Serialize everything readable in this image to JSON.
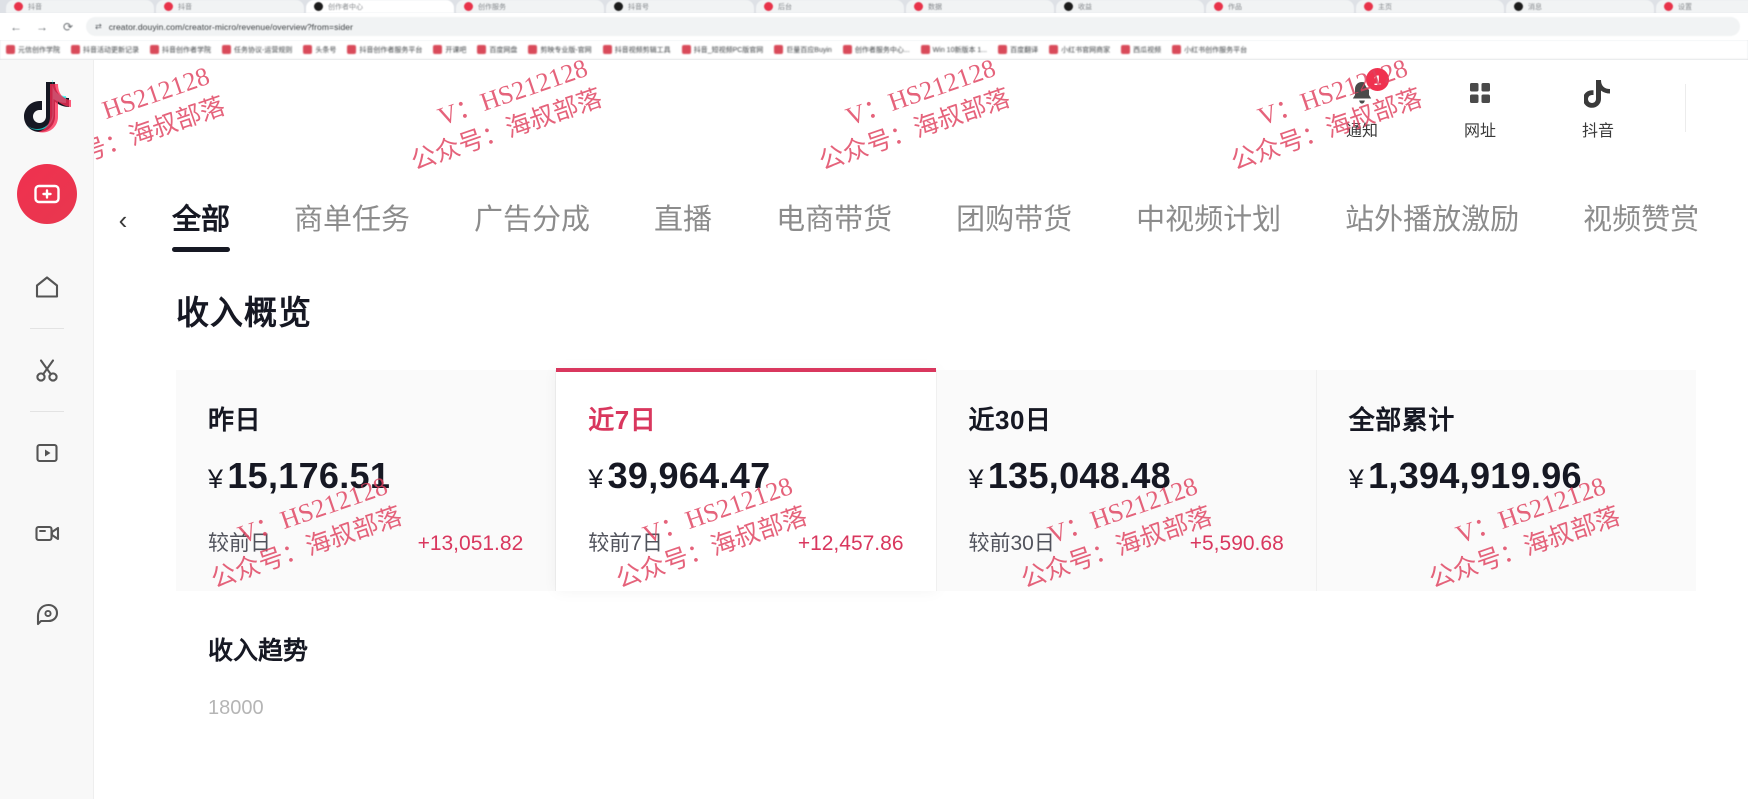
{
  "browser": {
    "url": "creator.douyin.com/creator-micro/revenue/overview?from=sider",
    "nav": {
      "back": "←",
      "forward": "→",
      "reload": "⟳"
    },
    "lock_icon": "site-info-icon",
    "tabs": [
      {
        "title": "抖音",
        "active": false
      },
      {
        "title": "抖音",
        "active": false
      },
      {
        "title": "创作者中心",
        "active": true
      },
      {
        "title": "创作服务",
        "active": false
      },
      {
        "title": "抖音号",
        "active": false
      },
      {
        "title": "后台",
        "active": false
      },
      {
        "title": "数据",
        "active": false
      },
      {
        "title": "收益",
        "active": false
      },
      {
        "title": "作品",
        "active": false
      },
      {
        "title": "主页",
        "active": false
      },
      {
        "title": "消息",
        "active": false
      },
      {
        "title": "设置",
        "active": false
      }
    ],
    "bookmarks": [
      "元信创作学院",
      "抖音活动更新记录",
      "抖音创作者学院",
      "任务协议-运营规则",
      "头条号",
      "抖音创作者服务平台",
      "开课吧",
      "百度网盘",
      "剪映专业版-官网",
      "抖音视频剪辑工具",
      "抖音_短视频PC版官网",
      "巨量百应Buyin",
      "创作者服务中心...",
      "Win 10新版本 1...",
      "百度翻译",
      "小红书官网商家",
      "西瓜视频",
      "小红书创作服务平台"
    ]
  },
  "sidebar": {
    "logo": "douyin-logo",
    "upload_label": "upload-video-button",
    "items": [
      {
        "name": "home",
        "icon": "home-icon"
      },
      {
        "name": "editor",
        "icon": "scissors-icon"
      },
      {
        "name": "play",
        "icon": "play-box-icon"
      },
      {
        "name": "live",
        "icon": "video-camera-icon"
      },
      {
        "name": "assistant",
        "icon": "assistant-icon"
      }
    ]
  },
  "header": {
    "actions": [
      {
        "id": "notification",
        "label": "通知",
        "icon": "bell-icon",
        "badge": "1"
      },
      {
        "id": "website",
        "label": "网址",
        "icon": "grid-icon",
        "badge": ""
      },
      {
        "id": "douyin",
        "label": "抖音",
        "icon": "douyin-note-icon",
        "badge": ""
      }
    ]
  },
  "nav": {
    "back_arrow": "‹",
    "tabs": [
      {
        "label": "全部",
        "active": true
      },
      {
        "label": "商单任务",
        "active": false
      },
      {
        "label": "广告分成",
        "active": false
      },
      {
        "label": "直播",
        "active": false
      },
      {
        "label": "电商带货",
        "active": false
      },
      {
        "label": "团购带货",
        "active": false
      },
      {
        "label": "中视频计划",
        "active": false
      },
      {
        "label": "站外播放激励",
        "active": false
      },
      {
        "label": "视频赞赏",
        "active": false
      }
    ]
  },
  "main": {
    "title": "收入概览",
    "currency_symbol": "¥",
    "cards": [
      {
        "label": "昨日",
        "value": "15,176.51",
        "compare_label": "较前日",
        "compare_value": "+13,051.82",
        "active": false
      },
      {
        "label": "近7日",
        "value": "39,964.47",
        "compare_label": "较前7日",
        "compare_value": "+12,457.86",
        "active": true
      },
      {
        "label": "近30日",
        "value": "135,048.48",
        "compare_label": "较前30日",
        "compare_value": "+5,590.68",
        "active": false
      },
      {
        "label": "全部累计",
        "value": "1,394,919.96",
        "compare_label": "",
        "compare_value": "",
        "active": false
      }
    ],
    "trend": {
      "title": "收入趋势",
      "axis_top_label": "18000"
    }
  },
  "watermarks": [
    {
      "line1": "V：HS212128",
      "line2": "公众号：海叔部落"
    }
  ],
  "colors": {
    "accent_pink": "#d9375e",
    "brand_red": "#f0314f",
    "text_primary": "#161823",
    "text_secondary": "#8c8c8c",
    "watermark": "#e0415f"
  }
}
